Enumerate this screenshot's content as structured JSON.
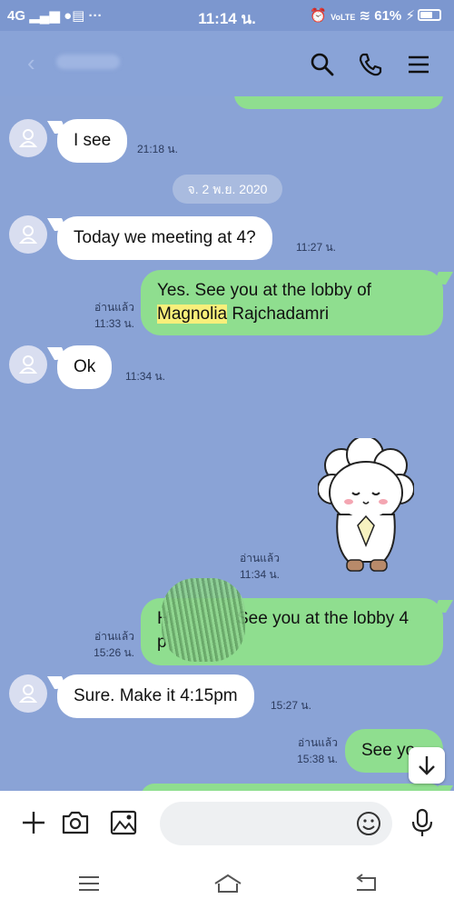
{
  "status_bar": {
    "network": "4G",
    "time": "11:14 น.",
    "battery": "61%"
  },
  "header": {
    "icons": [
      "back-arrow-icon",
      "search-icon",
      "phone-icon",
      "menu-icon"
    ]
  },
  "chat": {
    "date_separator": "จ. 2 พ.ย. 2020",
    "messages": [
      {
        "text": "I see",
        "time": "21:18 น."
      },
      {
        "text": "Today we meeting at 4?",
        "time": "11:27 น."
      },
      {
        "text_line1": "Yes. See you at the lobby of",
        "highlight": "Magnolia",
        "text_line2_rest": " Rajchadamri",
        "read": "อ่านแล้ว",
        "time": "11:33 น."
      },
      {
        "text": "Ok",
        "time": "11:34 น."
      },
      {
        "read": "อ่านแล้ว",
        "time": "11:34 น."
      },
      {
        "text_line1_prefix": "H",
        "text_line1_suffix": "See you at the lobby 4",
        "text_line2": "p",
        "read": "อ่านแล้ว",
        "time": "15:26 น."
      },
      {
        "text": "Sure. Make it 4:15pm",
        "time": "15:27 น."
      },
      {
        "text": "See yo",
        "read": "อ่านแล้ว",
        "time": "15:38 น."
      }
    ]
  },
  "input_bar": {
    "placeholder": "",
    "icons": [
      "plus-icon",
      "camera-icon",
      "image-icon",
      "emoji-icon",
      "microphone-icon"
    ]
  },
  "nav_bar": {
    "icons": [
      "recents-icon",
      "home-icon",
      "back-icon"
    ]
  },
  "colors": {
    "background": "#8aa3d6",
    "outgoing_bubble": "#8fde8f",
    "incoming_bubble": "#ffffff",
    "highlight": "#f8ef7a"
  }
}
